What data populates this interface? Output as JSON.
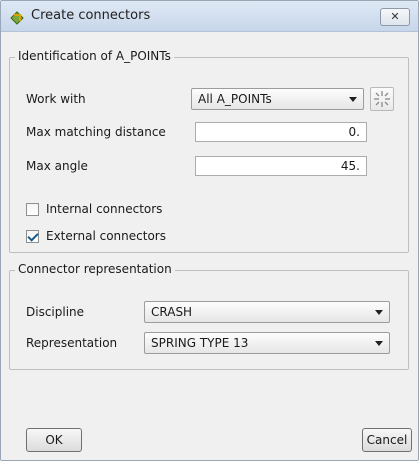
{
  "window": {
    "title": "Create connectors",
    "close_label": "✕"
  },
  "identification": {
    "legend": "Identification of A_POINTs",
    "work_with_label": "Work with",
    "work_with_value": "All A_POINTs",
    "max_distance_label": "Max matching distance",
    "max_distance_value": "0.",
    "max_angle_label": "Max angle",
    "max_angle_value": "45.",
    "internal_label": "Internal connectors",
    "internal_checked": false,
    "external_label": "External connectors",
    "external_checked": true
  },
  "representation": {
    "legend": "Connector representation",
    "discipline_label": "Discipline",
    "discipline_value": "CRASH",
    "representation_label": "Representation",
    "representation_value": "SPRING TYPE 13"
  },
  "buttons": {
    "ok": "OK",
    "cancel": "Cancel"
  },
  "colors": {
    "titlebar": "#c7d6ea",
    "accent_check": "#1c5a8a"
  }
}
